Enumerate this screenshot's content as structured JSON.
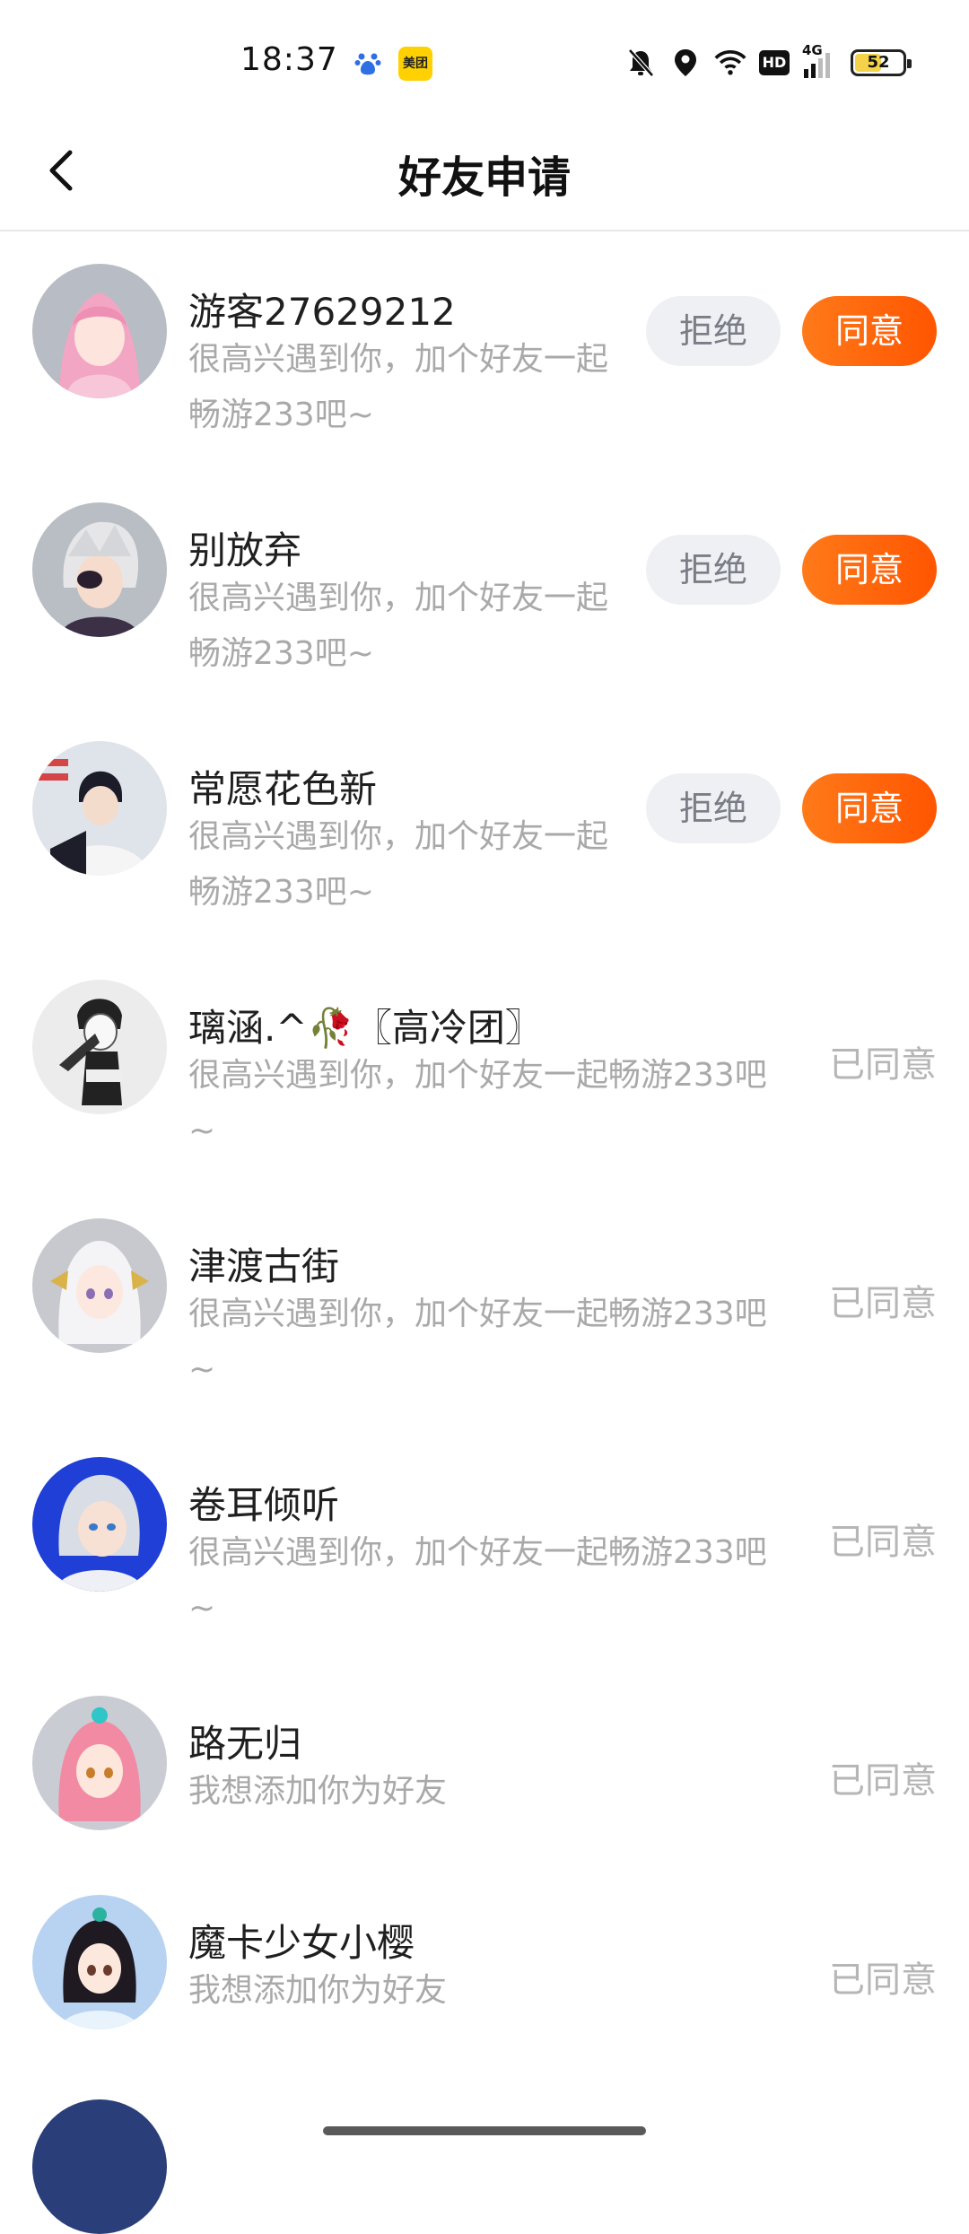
{
  "status_bar": {
    "time": "18:37",
    "icons": [
      "baidu-icon",
      "meituan-icon",
      "mute-bell-icon",
      "location-icon",
      "wifi-icon",
      "hd-icon",
      "signal-4g-icon",
      "battery-icon"
    ],
    "meituan_label": "美团",
    "hd_label": "HD",
    "network_label": "4G",
    "battery_level": "52"
  },
  "header": {
    "title": "好友申请"
  },
  "actions": {
    "reject_label": "拒绝",
    "agree_label": "同意"
  },
  "colors": {
    "accent": "#FF6A0E",
    "reject_bg": "#EEF0F4",
    "muted_text": "#A9A9A9"
  },
  "requests": [
    {
      "name": "游客27629212",
      "message": "很高兴遇到你，加个好友一起畅游233吧~",
      "status": "pending"
    },
    {
      "name": "别放弃",
      "message": "很高兴遇到你，加个好友一起畅游233吧~",
      "status": "pending"
    },
    {
      "name": "常愿花色新",
      "message": "很高兴遇到你，加个好友一起畅游233吧~",
      "status": "pending"
    },
    {
      "name": "璃涵.^🥀〖高冷团〗",
      "message": "很高兴遇到你，加个好友一起畅游233吧~",
      "status": "已同意"
    },
    {
      "name": "津渡古街",
      "message": "很高兴遇到你，加个好友一起畅游233吧~",
      "status": "已同意"
    },
    {
      "name": "卷耳倾听",
      "message": "很高兴遇到你，加个好友一起畅游233吧~",
      "status": "已同意"
    },
    {
      "name": "路无归",
      "message": "我想添加你为好友",
      "status": "已同意"
    },
    {
      "name": "魔卡少女小樱",
      "message": "我想添加你为好友",
      "status": "已同意"
    }
  ]
}
